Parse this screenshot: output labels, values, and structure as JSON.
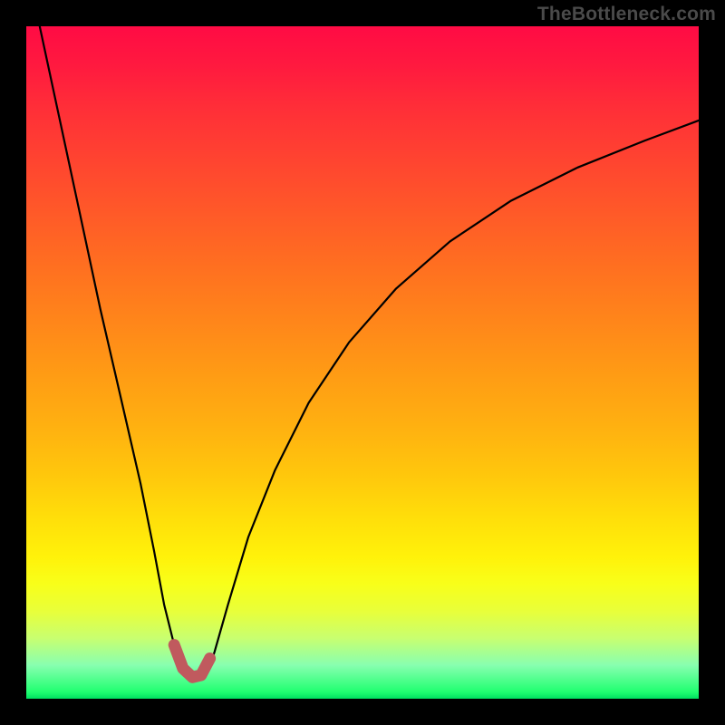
{
  "watermark": "TheBottleneck.com",
  "colors": {
    "background": "#000000",
    "curve": "#000000",
    "marker_stroke": "#c05a5e",
    "marker_fill": "#c05a5e",
    "gradient_top": "#ff0b44",
    "gradient_bottom": "#00e060"
  },
  "chart_data": {
    "type": "line",
    "title": "",
    "xlabel": "",
    "ylabel": "",
    "xlim": [
      0,
      100
    ],
    "ylim": [
      0,
      100
    ],
    "grid": false,
    "legend": false,
    "annotations": [
      "TheBottleneck.com"
    ],
    "series": [
      {
        "name": "bottleneck-curve",
        "x": [
          2,
          5,
          8,
          11,
          14,
          17,
          19,
          20.5,
          22,
          23.5,
          25,
          26,
          27,
          28,
          30,
          33,
          37,
          42,
          48,
          55,
          63,
          72,
          82,
          92,
          100
        ],
        "y": [
          100,
          86,
          72,
          58,
          45,
          32,
          22,
          14,
          8,
          4,
          3,
          3,
          4,
          7,
          14,
          24,
          34,
          44,
          53,
          61,
          68,
          74,
          79,
          83,
          86
        ]
      }
    ],
    "marker": {
      "name": "optimal-range",
      "shape": "u",
      "x": [
        22,
        23.3,
        24.7,
        26,
        27.3
      ],
      "y": [
        8,
        4.5,
        3.2,
        3.5,
        6
      ]
    }
  }
}
